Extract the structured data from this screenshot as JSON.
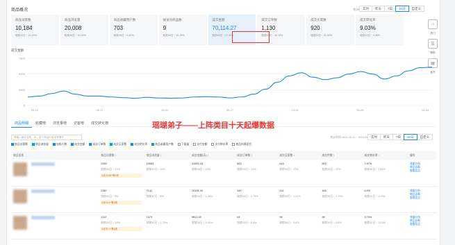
{
  "section_title": "商品概况",
  "date_range": "统计时间 2024-09-12 ~ 2024-09-18",
  "period_buttons": [
    "实时",
    "昨天",
    "7日",
    "30日",
    "自定义"
  ],
  "metrics": [
    {
      "label": "商品访客数",
      "value": "10,184",
      "compare": "较前30日 ↑ 10.24%"
    },
    {
      "label": "商品浏览量",
      "value": "20,008",
      "compare": "较前30日 ↑ 10.03%"
    },
    {
      "label": "商品收藏用户数",
      "value": "703",
      "compare": "较前30日 ↑ 5.40%"
    },
    {
      "label": "被访问商品数",
      "value": "9",
      "compare": "较前30日 ↑ 10.19%"
    },
    {
      "label": "成交金额",
      "value": "70,114.27",
      "compare": "较前30日 ↑ 47.00%"
    },
    {
      "label": "成交订单数",
      "value": "1,130",
      "compare": "较前30日 ↑ 42.10%"
    },
    {
      "label": "成交买家数",
      "value": "920",
      "compare": "较前30日 ↑ 31.32%"
    },
    {
      "label": "成交转化率",
      "value": "9.03%",
      "compare": "较前30日 ↑ 4.45%"
    }
  ],
  "sidebar": [
    {
      "icon": "shop-icon",
      "label": "热门"
    },
    {
      "icon": "document-icon",
      "label": "帮助"
    },
    {
      "icon": "chart-icon",
      "label": "官方"
    }
  ],
  "chart_data": {
    "type": "line",
    "title": "成交金额",
    "x": [
      "09-12",
      "09-17",
      "09-22",
      "09-27",
      "10-01",
      "09-28",
      "10-10"
    ],
    "yticks": [
      "0",
      "2500",
      "5000",
      "7500"
    ],
    "ylim": [
      0,
      7500
    ],
    "series": [
      {
        "values": [
          1350,
          1500,
          1900,
          2300,
          1800,
          1500,
          1500,
          1350,
          1250,
          1150,
          1300,
          1200,
          1150,
          1200,
          1350,
          1400,
          1350,
          1200,
          1350,
          1800,
          2600,
          3700,
          4700,
          5200,
          4500,
          4100,
          4400,
          5000,
          5400,
          5000,
          4200,
          4700,
          5500,
          6000,
          6100
        ]
      }
    ]
  },
  "tabs": [
    "商品明细",
    "收藏榜",
    "浏览量榜",
    "访客榜",
    "成交转化榜"
  ],
  "overlay_text": "瑶瑚弟子——上阵类目十天起爆数据",
  "watermark": "@瑶瑚弟子",
  "search_placeholder": "请输入商品名称、ID、多个商品ID用逗号隔开",
  "filter_range": "统计时间 2024-09-12 ~ 2024-09-18",
  "filters": [
    "商品访客数",
    "商品浏览量",
    "加购人数",
    "成交金额",
    "成交订单数",
    "成交买家数",
    "成交转化率",
    "商品收藏用户数",
    "下载量",
    "支付金额",
    "支付转化率",
    "商品所属类目"
  ],
  "table": {
    "headers": [
      "商品信息",
      "商品访客数 ↕",
      "商品浏览量 ↕",
      "成交金额(元) ↕",
      "成交订单数 ↕",
      "成交买家数 ↕",
      "成交件数 ↕",
      "成交转化率 ↕",
      "操作"
    ],
    "rows": [
      {
        "name": "···",
        "cells": [
          [
            "5352",
            "较前30日 ↑ 21%"
          ],
          [
            "10583",
            "较前30日 ↑ 10%"
          ],
          [
            "41553.18",
            "较前30日 ↑ 20%"
          ],
          [
            "863",
            "较前30日 ↑ 13%"
          ],
          [
            "618",
            "较前30日 ↑ 13%"
          ],
          [
            "503",
            "较前30日 ↑ 12%"
          ],
          [
            "7.87%",
            "较前30日 ↑ 7.31%"
          ]
        ],
        "tag": "4月23.65+等4类",
        "ops": [
          "流量分析",
          "商品诊断",
          "查看竞品"
        ]
      },
      {
        "name": "···",
        "cells": [
          [
            "2387",
            "较前30日 ↑ 9%"
          ],
          [
            "7142",
            "较前30日 ↑ 8%"
          ],
          [
            "23105.39",
            "较前30日 ↑ 1.38%"
          ],
          [
            "344",
            "较前30日 ↑ 1.79%"
          ],
          [
            "441",
            "较前30日 ↑ 1.21%"
          ],
          [
            "405",
            "较前30日 ↑ 1.75%"
          ],
          [
            "6.9%",
            "较前30日 ↑ 11.5%"
          ]
        ],
        "tag": "4月24.6+等4类",
        "ops": [
          "流量分析",
          "商品诊断",
          "查看竞品"
        ]
      },
      {
        "name": "···",
        "cells": [
          [
            "1112",
            "较前30日 ↓ 14%"
          ],
          [
            "1373",
            "较前30日 ↓ 1.75%"
          ],
          [
            "5812.39",
            "较前30日 ↓ 5.41%"
          ],
          [
            "64",
            "较前30日 ↓ 5.4%"
          ],
          [
            "96",
            "较前30日 ↓ 5.6%"
          ],
          [
            "96",
            "较前30日 ↓ 5.6%"
          ],
          [
            "3.75%",
            "较前30日 ↓ 13.5%"
          ]
        ],
        "tag": "4月30.1+等4类",
        "ops": [
          "流量分析",
          "商品诊断",
          "查看竞品"
        ]
      }
    ]
  }
}
